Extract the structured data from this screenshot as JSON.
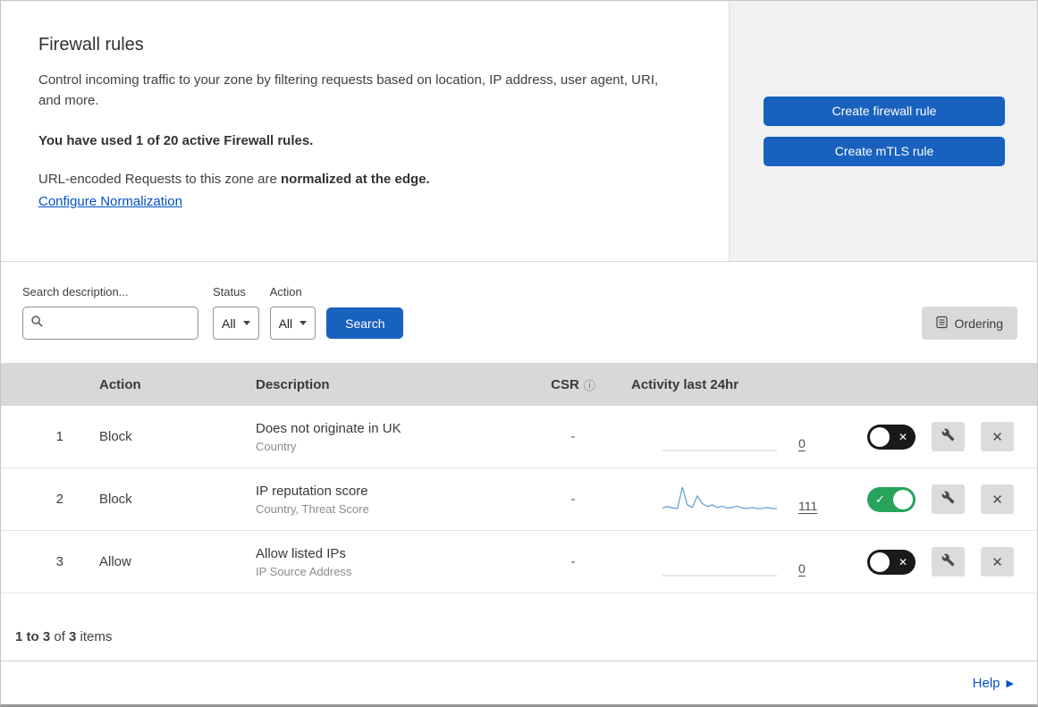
{
  "colors": {
    "accent-blue": "#1961be",
    "link-blue": "#0051c3",
    "toggle-green": "#28a35c",
    "spark-blue": "#6b9fd8",
    "header-gray": "#d8d8d8",
    "panel-gray": "#f1f1f1"
  },
  "header": {
    "title": "Firewall rules",
    "description": "Control incoming traffic to your zone by filtering requests based on location, IP address, user agent, URI, and more.",
    "usage": "You have used 1 of 20 active Firewall rules.",
    "normalization_prefix": "URL-encoded Requests to this zone are ",
    "normalization_bold": "normalized at the edge.",
    "normalization_link": "Configure Normalization",
    "create_firewall_button": "Create firewall rule",
    "create_mtls_button": "Create mTLS rule"
  },
  "filters": {
    "search_label": "Search description...",
    "search_value": "",
    "status_label": "Status",
    "status_value": "All",
    "action_label": "Action",
    "action_value": "All",
    "search_button": "Search",
    "ordering_button": "Ordering"
  },
  "table": {
    "columns": {
      "action": "Action",
      "description": "Description",
      "csr": "CSR",
      "activity": "Activity last 24hr"
    },
    "rows": [
      {
        "priority": "1",
        "action": "Block",
        "description": "Does not originate in UK",
        "fields": "Country",
        "csr": "-",
        "activity_count": "0",
        "enabled": false,
        "sparkline": []
      },
      {
        "priority": "2",
        "action": "Block",
        "description": "IP reputation score",
        "fields": "Country, Threat Score",
        "csr": "-",
        "activity_count": "111",
        "enabled": true,
        "sparkline": [
          2,
          2.5,
          2,
          1.8,
          9,
          3,
          2.2,
          6,
          3.5,
          2.5,
          3,
          2.2,
          2.6,
          2,
          2.2,
          2.6,
          2,
          1.8,
          2.2,
          1.8,
          1.8,
          2.2,
          1.8,
          1.8
        ]
      },
      {
        "priority": "3",
        "action": "Allow",
        "description": "Allow listed IPs",
        "fields": "IP Source Address",
        "csr": "-",
        "activity_count": "0",
        "enabled": false,
        "sparkline": []
      }
    ]
  },
  "footer": {
    "range": "1 to 3",
    "of_word": " of ",
    "total": "3",
    "items_word": " items",
    "help": "Help"
  }
}
